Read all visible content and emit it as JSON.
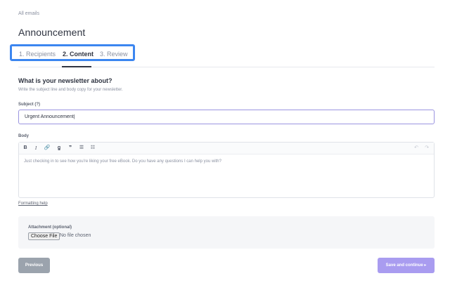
{
  "breadcrumb": "All emails",
  "page_title": "Announcement",
  "tabs": [
    {
      "label": "1. Recipients"
    },
    {
      "label": "2. Content"
    },
    {
      "label": "3. Review"
    }
  ],
  "section": {
    "title": "What is your newsletter about?",
    "subtitle": "Write the subject line and body copy for your newsletter."
  },
  "subject": {
    "label": "Subject (?)",
    "value": "Urgent Announcement|"
  },
  "body": {
    "label": "Body",
    "toolbar": {
      "bold": "B",
      "italic": "I",
      "link": "🔗",
      "heading": "ꬶ",
      "quote": "❞",
      "bullet_list": "☰",
      "numbered_list": "☷",
      "undo": "↶",
      "redo": "↷"
    },
    "placeholder": "Just checking in to see how you're liking your free eBook. Do you have any questions I can help you with?"
  },
  "formatting_help": "Formatting help",
  "attachment": {
    "label": "Attachment (optional)",
    "choose_file": "Choose File",
    "no_file": "No file chosen"
  },
  "buttons": {
    "previous": "Previous",
    "save": "Save and continue ▸"
  },
  "colors": {
    "accent": "#3c86f0",
    "primary": "#a99cf0",
    "secondary": "#9ba3ad"
  }
}
